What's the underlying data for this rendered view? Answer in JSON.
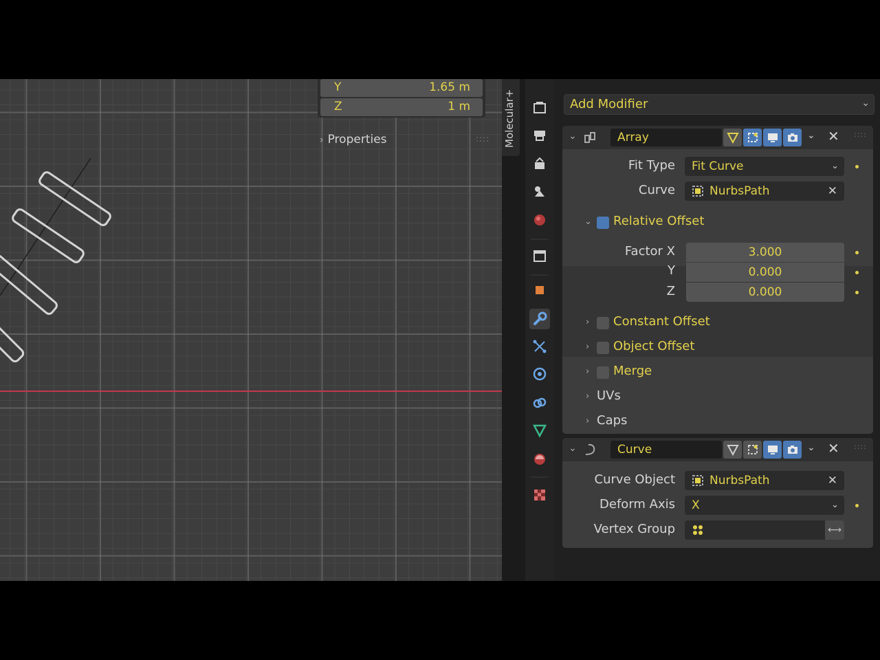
{
  "viewport": {
    "transform": [
      {
        "axis": "Y",
        "value": "1.65 m"
      },
      {
        "axis": "Z",
        "value": "1 m"
      }
    ],
    "properties_header": "Properties",
    "side_tab": "Molecular+"
  },
  "tabs": [
    {
      "name": "render-tab-icon"
    },
    {
      "name": "output-tab-icon"
    },
    {
      "name": "view-layer-tab-icon"
    },
    {
      "name": "scene-tab-icon"
    },
    {
      "name": "world-tab-icon"
    },
    {
      "name": "collection-tab-icon"
    },
    {
      "name": "object-tab-icon"
    },
    {
      "name": "modifier-tab-icon"
    },
    {
      "name": "particles-tab-icon"
    },
    {
      "name": "physics-tab-icon"
    },
    {
      "name": "constraints-tab-icon"
    },
    {
      "name": "data-tab-icon"
    },
    {
      "name": "material-tab-icon"
    },
    {
      "name": "texture-tab-icon"
    }
  ],
  "add_modifier": "Add Modifier",
  "array": {
    "name": "Array",
    "fit_type_label": "Fit Type",
    "fit_type_value": "Fit Curve",
    "curve_label": "Curve",
    "curve_value": "NurbsPath",
    "relative_offset": "Relative Offset",
    "factor_x_label": "Factor X",
    "factor_y_label": "Y",
    "factor_z_label": "Z",
    "factor_x": "3.000",
    "factor_y": "0.000",
    "factor_z": "0.000",
    "constant_offset": "Constant Offset",
    "object_offset": "Object Offset",
    "merge": "Merge",
    "uvs": "UVs",
    "caps": "Caps"
  },
  "curve_mod": {
    "name": "Curve",
    "curve_object_label": "Curve Object",
    "curve_object_value": "NurbsPath",
    "deform_axis_label": "Deform Axis",
    "deform_axis_value": "X",
    "vertex_group_label": "Vertex Group",
    "vertex_group_value": ""
  },
  "colors": {
    "accent_text": "#e2d14c",
    "toggle_on": "#4b79b5",
    "x_axis": "#c0384e"
  }
}
